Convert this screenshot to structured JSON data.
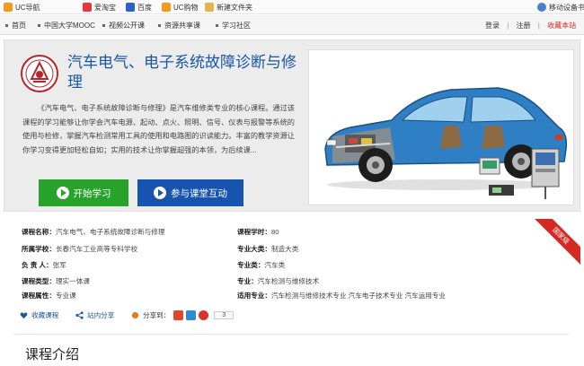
{
  "bookmarks": {
    "items": [
      {
        "label": "UC导航",
        "color": "#f29a1d"
      },
      {
        "label": "爱淘宝",
        "color": "#e4393c"
      },
      {
        "label": "百度",
        "color": "#2d61c9"
      },
      {
        "label": "UC购物",
        "color": "#f29a1d"
      },
      {
        "label": "新建文件夹",
        "color": "#e2b44a"
      }
    ],
    "mobile_label": "移动设备书"
  },
  "nav": {
    "items": [
      "首页",
      "中国大学MOOC",
      "视频公开课",
      "资源共享课",
      "学习社区"
    ],
    "login": "登录",
    "register": "注册",
    "favorite": "收藏本站",
    "sep": "|"
  },
  "course": {
    "title": "汽车电气、电子系统故障诊断与修理",
    "description": "《汽车电气、电子系统故障诊断与修理》是汽车维修类专业的核心课程。通过该课程的学习能够让你学会汽车电源、起动、点火、照明、信号、仪表与报警等系统的使用与检修，掌握汽车检测常用工具的使用和电路图的识读能力。丰富的教学资源让你学习变得更加轻松自如；实用的技术让你掌握超强的本领，为后续课...",
    "start_button": "开始学习",
    "join_button": "参与课堂互动"
  },
  "info": {
    "badge": "国家级",
    "rows_left": [
      {
        "label": "课程名称：",
        "value": "汽车电气、电子系统故障诊断与修理"
      },
      {
        "label": "所属学校：",
        "value": "长春汽车工业高等专科学校"
      },
      {
        "label": "负 责 人：",
        "value": "张军"
      },
      {
        "label": "课程类型：",
        "value": "理实一体课"
      },
      {
        "label": "课程属性：",
        "value": "专业课"
      }
    ],
    "rows_right": [
      {
        "label": "课程学时：",
        "value": "80"
      },
      {
        "label": "专业大类：",
        "value": "制造大类"
      },
      {
        "label": "专业类：",
        "value": "汽车类"
      },
      {
        "label": "专业：",
        "value": "汽车检测与维修技术"
      },
      {
        "label": "适用专业：",
        "value": "汽车检测与维修技术专业 汽车电子技术专业 汽车运用专业"
      }
    ]
  },
  "actions": {
    "favorite": "收藏课程",
    "site_share": "站内分享",
    "share_to": "分享到：",
    "share_count": "3"
  },
  "section": {
    "title": "课程介绍"
  }
}
